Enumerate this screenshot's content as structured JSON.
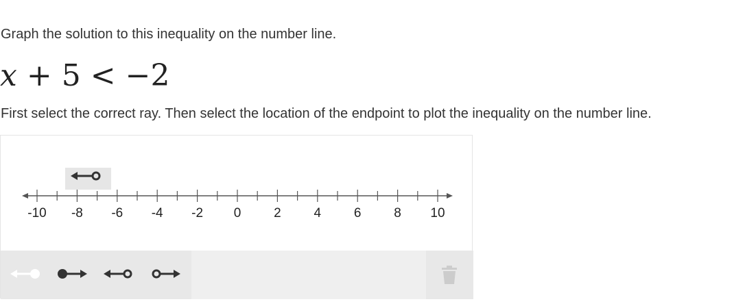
{
  "prompt": "Graph the solution to this inequality on the number line.",
  "equation": {
    "variable": "x",
    "plus": "+",
    "constant": "5",
    "relation": "<",
    "rhs": "−2"
  },
  "instruction": "First select the correct ray. Then select the location of the endpoint to plot the inequality on the number line.",
  "number_line": {
    "min": -10,
    "max": 10,
    "minor_step": 1,
    "label_step": 2,
    "tick_labels": [
      "-10",
      "-8",
      "-6",
      "-4",
      "-2",
      "0",
      "2",
      "4",
      "6",
      "8",
      "10"
    ]
  },
  "pending_ray": {
    "icon": "ray-left-open-icon",
    "background": "#e6e6e6"
  },
  "toolbar": {
    "tools": [
      {
        "icon": "ray-left-closed-icon",
        "selected": true
      },
      {
        "icon": "ray-right-closed-icon",
        "selected": false
      },
      {
        "icon": "ray-left-open-icon",
        "selected": false
      },
      {
        "icon": "ray-right-open-icon",
        "selected": false
      }
    ],
    "delete_icon": "trash-icon"
  },
  "colors": {
    "text": "#333333",
    "line": "#555555",
    "selected_tool_bg": "#666666",
    "toolbar_bg": "#e8e8e8",
    "icon_dark": "#333333",
    "icon_light": "#ffffff",
    "trash": "#cccccc"
  }
}
